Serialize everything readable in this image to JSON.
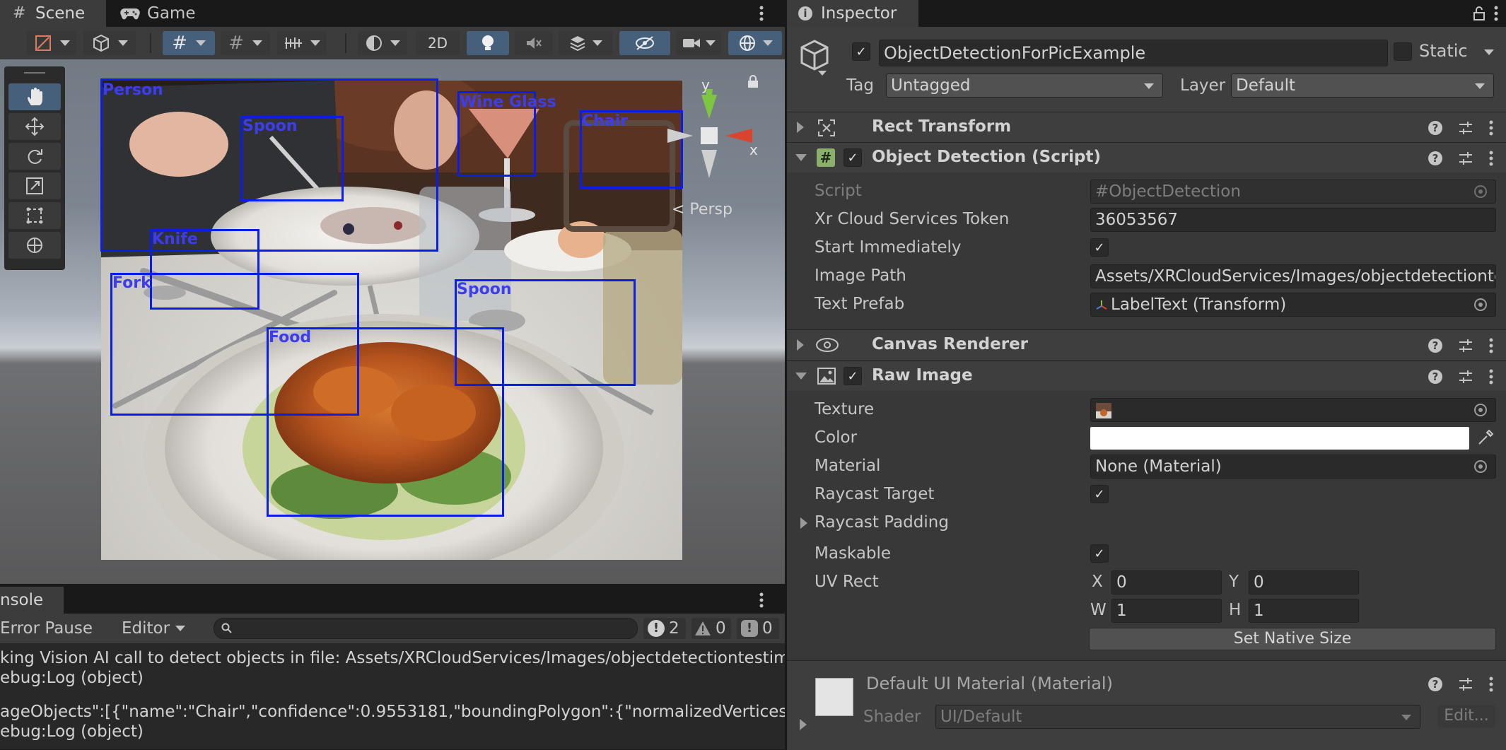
{
  "scene_panel": {
    "tabs": [
      {
        "label": "Scene",
        "icon": "hash-icon"
      },
      {
        "label": "Game",
        "icon": "gamepad-icon"
      }
    ],
    "toolbar": {
      "mode_2d_label": "2D"
    },
    "gizmo": {
      "y_label": "y",
      "x_label": "x",
      "persp_label": "< Persp"
    },
    "detections": [
      {
        "label": "Person"
      },
      {
        "label": "Spoon"
      },
      {
        "label": "Wine Glass"
      },
      {
        "label": "Chair"
      },
      {
        "label": "Knife"
      },
      {
        "label": "Fork"
      },
      {
        "label": "Spoon"
      },
      {
        "label": "Food"
      }
    ]
  },
  "console_panel": {
    "tab_label": "nsole",
    "toolbar": {
      "error_pause": "Error Pause",
      "editor": "Editor",
      "search_placeholder": "",
      "info_count": "2",
      "warning_count": "0",
      "error_count": "0"
    },
    "lines": [
      "king Vision AI call to detect objects in file: Assets/XRCloudServices/Images/objectdetectiontestimage",
      "ebug:Log (object)",
      "ageObjects\":[{\"name\":\"Chair\",\"confidence\":0.9553181,\"boundingPolygon\":{\"normalizedVertices\":[{\"x",
      "ebug:Log (object)"
    ]
  },
  "inspector": {
    "tab_label": "Inspector",
    "object": {
      "name": "ObjectDetectionForPicExample",
      "static_label": "Static",
      "tag_label": "Tag",
      "tag_value": "Untagged",
      "layer_label": "Layer",
      "layer_value": "Default"
    },
    "components": {
      "rect_transform": {
        "title": "Rect Transform"
      },
      "object_detection": {
        "title": "Object Detection (Script)",
        "script_label": "Script",
        "script_value": "ObjectDetection",
        "token_label": "Xr Cloud Services Token",
        "token_value": "36053567",
        "start_label": "Start Immediately",
        "image_path_label": "Image Path",
        "image_path_value": "Assets/XRCloudServices/Images/objectdetectiontestimage",
        "text_prefab_label": "Text Prefab",
        "text_prefab_value": "LabelText (Transform)"
      },
      "canvas_renderer": {
        "title": "Canvas Renderer"
      },
      "raw_image": {
        "title": "Raw Image",
        "texture_label": "Texture",
        "color_label": "Color",
        "color_value": "#ffffff",
        "material_label": "Material",
        "material_value": "None (Material)",
        "raycast_target_label": "Raycast Target",
        "raycast_padding_label": "Raycast Padding",
        "maskable_label": "Maskable",
        "uv_rect_label": "UV Rect",
        "uv": {
          "x_label": "X",
          "x_value": "0",
          "y_label": "Y",
          "y_value": "0",
          "w_label": "W",
          "w_value": "1",
          "h_label": "H",
          "h_value": "1"
        },
        "set_native_size": "Set Native Size"
      },
      "material": {
        "title": "Default UI Material (Material)",
        "shader_label": "Shader",
        "shader_value": "UI/Default",
        "edit_label": "Edit..."
      }
    }
  },
  "colors": {
    "selection_blue": "#46607c",
    "detection_blue": "#0a1ee8",
    "gizmo_y": "#7ec641",
    "gizmo_x": "#d8442e"
  }
}
